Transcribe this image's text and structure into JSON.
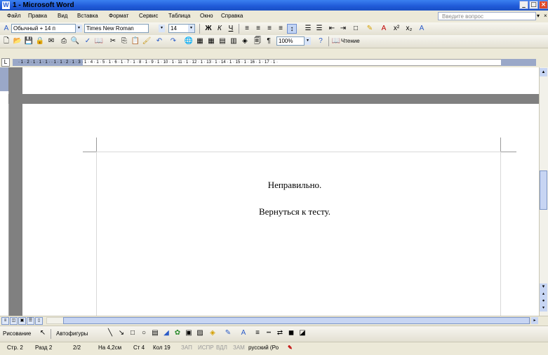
{
  "window": {
    "title": "1 - Microsoft Word"
  },
  "menu": {
    "items": [
      "Файл",
      "Правка",
      "Вид",
      "Вставка",
      "Формат",
      "Сервис",
      "Таблица",
      "Окно",
      "Справка"
    ],
    "help_placeholder": "Введите вопрос"
  },
  "formatting": {
    "style": "Обычный + 14 п",
    "font": "Times New Roman",
    "size": "14"
  },
  "standard": {
    "zoom": "100%",
    "read_mode": "Чтение"
  },
  "document": {
    "line1": "Неправильно.",
    "line2": "Вернуться к тесту."
  },
  "drawing": {
    "draw_label": "Рисование",
    "autoshapes_label": "Автофигуры"
  },
  "status": {
    "page": "Стр. 2",
    "section": "Разд 2",
    "pages": "2/2",
    "at": "На 4,2см",
    "line": "Ст 4",
    "col": "Кол 19",
    "rec": "ЗАП",
    "trk": "ИСПР",
    "ext": "ВДЛ",
    "ovr": "ЗАМ",
    "language": "русский (Ро"
  },
  "ruler_text": "· 1 · 2 · 1 · 1 · 1 ·  · 1 · 1 · 2 · 1 · 3 · 1 · 4 · 1 · 5 · 1 · 6 · 1 · 7 · 1 · 8 · 1 · 9 · 1 · 10 · 1 · 11 · 1 · 12 · 1 · 13 · 1 · 14 · 1 · 15 · 1 · 16 · 1 · 17 · 1 ·"
}
